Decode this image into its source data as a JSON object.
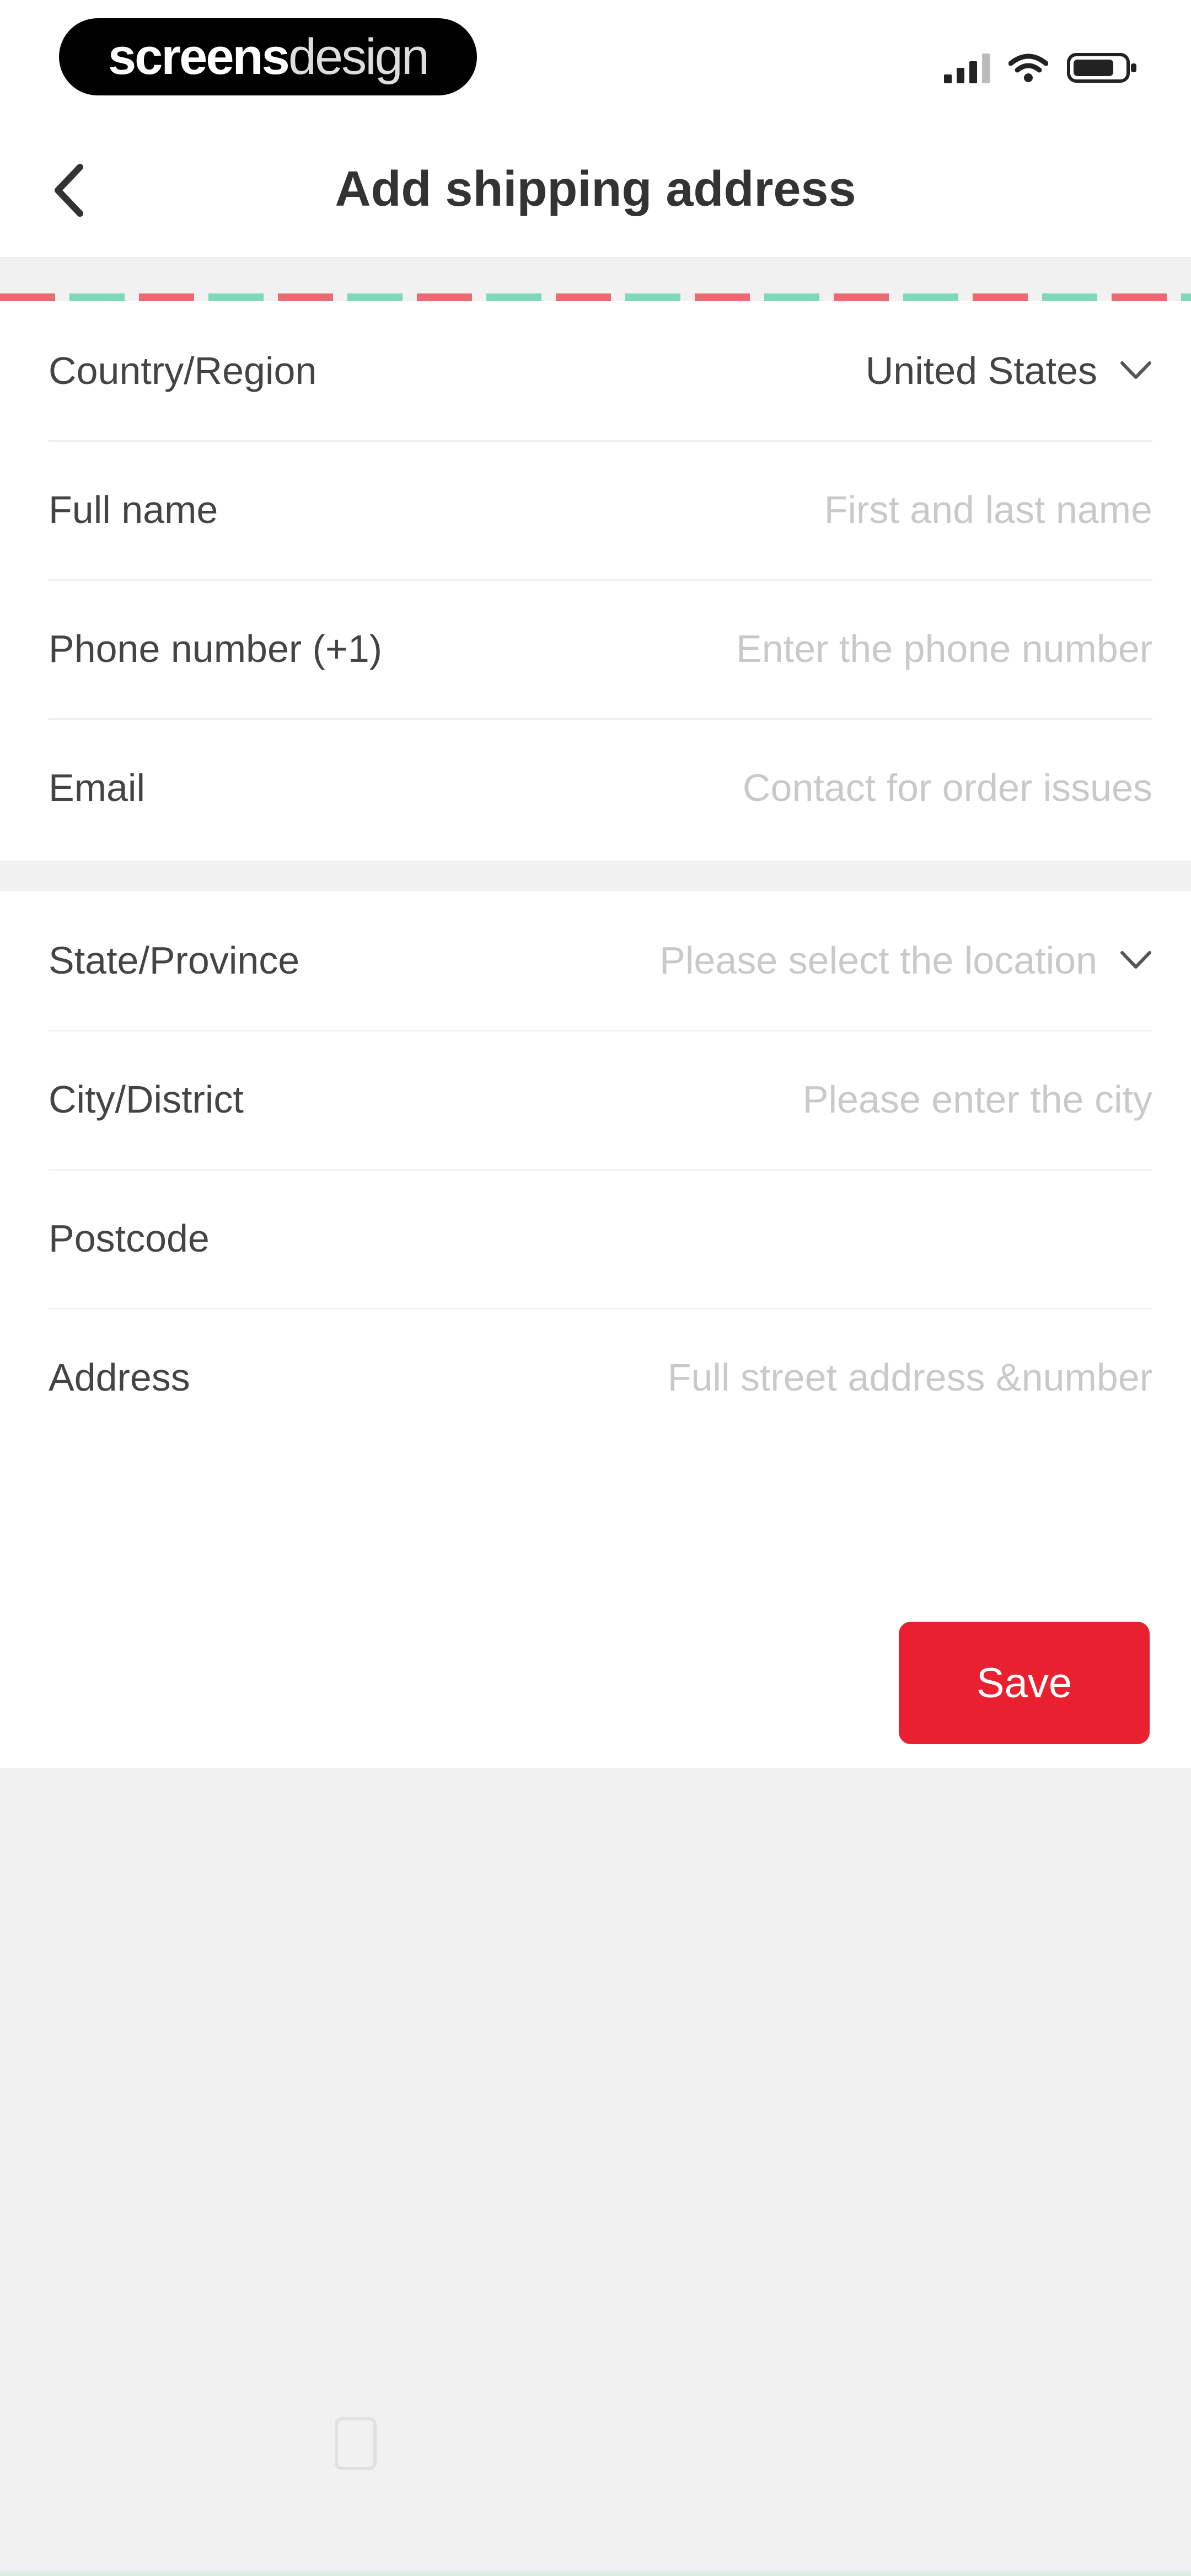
{
  "status_bar": {
    "brand_part1": "screens",
    "brand_part2": "design"
  },
  "header": {
    "title": "Add shipping address"
  },
  "contact_section": {
    "rows": [
      {
        "label": "Country/Region",
        "value": "United States"
      },
      {
        "label": "Full name",
        "placeholder": "First and last name"
      },
      {
        "label": "Phone number (+1)",
        "placeholder": "Enter the phone number"
      },
      {
        "label": "Email",
        "placeholder": "Contact for order issues"
      }
    ]
  },
  "address_section": {
    "rows": [
      {
        "label": "State/Province",
        "placeholder": "Please select the location"
      },
      {
        "label": "City/District",
        "placeholder": "Please enter the city"
      },
      {
        "label": "Postcode",
        "placeholder": ""
      },
      {
        "label": "Address",
        "placeholder": "Full street address &number"
      }
    ]
  },
  "actions": {
    "save_label": "Save"
  },
  "colors": {
    "accent": "#e8202f",
    "stripe_red": "#e96b72",
    "stripe_green": "#7fd8b8",
    "background": "#f1f1f1"
  }
}
